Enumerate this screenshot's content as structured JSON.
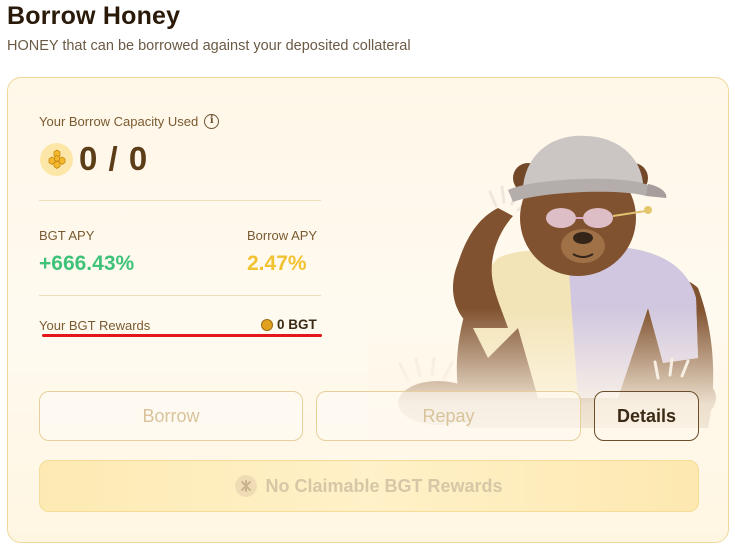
{
  "header": {
    "title": "Borrow Honey",
    "subtitle": "HONEY that can be borrowed against your deposited collateral"
  },
  "capacity": {
    "label": "Your Borrow Capacity Used",
    "value": "0 / 0",
    "icon": "honey-token-icon"
  },
  "stats": {
    "bgt_apy_label": "BGT APY",
    "bgt_apy_value": "+666.43%",
    "borrow_apy_label": "Borrow APY",
    "borrow_apy_value": "2.47%"
  },
  "rewards": {
    "label": "Your BGT Rewards",
    "value": "0 BGT"
  },
  "buttons": {
    "borrow": "Borrow",
    "repay": "Repay",
    "details": "Details"
  },
  "claim": {
    "label": "No Claimable BGT Rewards"
  },
  "colors": {
    "apy_green": "#3fc37a",
    "apy_yellow": "#f1c232",
    "card_border": "#f0d79b",
    "underline_red": "#e3161b"
  }
}
